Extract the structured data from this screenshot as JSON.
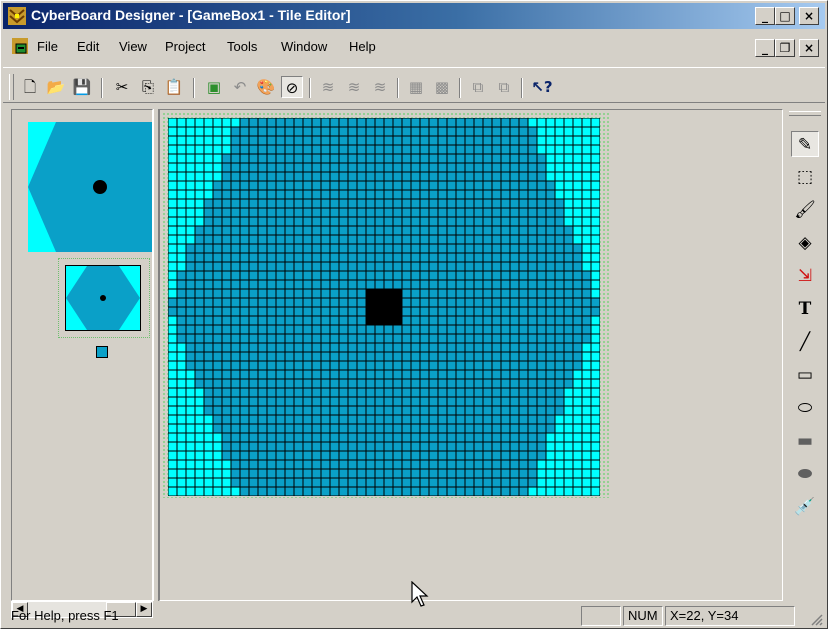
{
  "window": {
    "title": "CyberBoard Designer - [GameBox1 - Tile Editor]",
    "caption_buttons": [
      "_",
      "□",
      "×"
    ]
  },
  "menu": {
    "items": [
      "File",
      "Edit",
      "View",
      "Project",
      "Tools",
      "Window",
      "Help"
    ],
    "mdi_buttons": [
      "_",
      "❐",
      "×"
    ]
  },
  "toolbar": {
    "buttons": [
      {
        "name": "new-icon",
        "glyph": "🗋",
        "enabled": true
      },
      {
        "name": "open-icon",
        "glyph": "📂",
        "enabled": true
      },
      {
        "name": "save-icon",
        "glyph": "💾",
        "enabled": true
      },
      {
        "name": "cut-icon",
        "glyph": "✂",
        "enabled": true
      },
      {
        "name": "copy-icon",
        "glyph": "⎘",
        "enabled": true
      },
      {
        "name": "paste-icon",
        "glyph": "📋",
        "enabled": true
      },
      {
        "name": "board-icon",
        "glyph": "▣",
        "enabled": true
      },
      {
        "name": "rotate-icon",
        "glyph": "↶",
        "enabled": false
      },
      {
        "name": "palette-icon",
        "glyph": "🎨",
        "enabled": true
      },
      {
        "name": "null-icon",
        "glyph": "⊘",
        "enabled": true,
        "pressed": true
      },
      {
        "name": "layer-1-icon",
        "glyph": "≋",
        "enabled": false
      },
      {
        "name": "layer-2-icon",
        "glyph": "≋",
        "enabled": false
      },
      {
        "name": "layer-3-icon",
        "glyph": "≋",
        "enabled": false
      },
      {
        "name": "grid-icon",
        "glyph": "▦",
        "enabled": false
      },
      {
        "name": "fine-grid-icon",
        "glyph": "▩",
        "enabled": false
      },
      {
        "name": "bring-front-icon",
        "glyph": "⧉",
        "enabled": false
      },
      {
        "name": "send-back-icon",
        "glyph": "⧉",
        "enabled": false
      },
      {
        "name": "context-help-icon",
        "glyph": "↖?",
        "enabled": true
      }
    ]
  },
  "tile": {
    "cols": 48,
    "rows": 42,
    "colors": {
      "outer": "#00ffff",
      "inner": "#0aa0c8",
      "dot": "#000000",
      "gridline": "#000000",
      "border_dots": "#9bd49b"
    }
  },
  "tools": [
    {
      "name": "pencil-tool-icon",
      "glyph": "✎",
      "selected": true
    },
    {
      "name": "select-rect-tool-icon",
      "glyph": "⬚"
    },
    {
      "name": "brush-tool-icon",
      "glyph": "🖌"
    },
    {
      "name": "fill-tool-icon",
      "glyph": "◈"
    },
    {
      "name": "color-swap-tool-icon",
      "glyph": "⇲"
    },
    {
      "name": "text-tool-icon",
      "glyph": "T"
    },
    {
      "name": "line-tool-icon",
      "glyph": "╱"
    },
    {
      "name": "rectangle-tool-icon",
      "glyph": "▭"
    },
    {
      "name": "ellipse-tool-icon",
      "glyph": "⬭"
    },
    {
      "name": "filled-rectangle-tool-icon",
      "glyph": "▬"
    },
    {
      "name": "filled-ellipse-tool-icon",
      "glyph": "⬬"
    },
    {
      "name": "eyedropper-tool-icon",
      "glyph": "💉"
    }
  ],
  "status": {
    "help": "For Help, press F1",
    "num": "NUM",
    "coords": "X=22, Y=34"
  }
}
